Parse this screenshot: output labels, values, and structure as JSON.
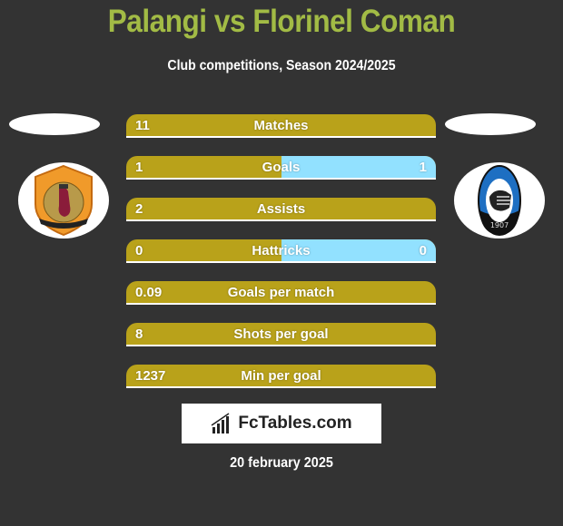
{
  "header": {
    "title": "Palangi vs Florinel Coman",
    "subtitle": "Club competitions, Season 2024/2025"
  },
  "colors": {
    "background": "#333333",
    "title": "#a2bb45",
    "left_bar": "#b9a21a",
    "right_bar": "#92e1ff"
  },
  "left_team": {
    "logo_icon": "qatar-sc-crest-icon"
  },
  "right_team": {
    "logo_icon": "atalanta-crest-icon"
  },
  "stats": [
    {
      "label": "Matches",
      "left": "11",
      "right": "",
      "right_share": 0
    },
    {
      "label": "Goals",
      "left": "1",
      "right": "1",
      "right_share": 0.5
    },
    {
      "label": "Assists",
      "left": "2",
      "right": "",
      "right_share": 0
    },
    {
      "label": "Hattricks",
      "left": "0",
      "right": "0",
      "right_share": 0.5
    },
    {
      "label": "Goals per match",
      "left": "0.09",
      "right": "",
      "right_share": 0
    },
    {
      "label": "Shots per goal",
      "left": "8",
      "right": "",
      "right_share": 0
    },
    {
      "label": "Min per goal",
      "left": "1237",
      "right": "",
      "right_share": 0
    }
  ],
  "brand": {
    "icon": "bar-chart-icon",
    "text": "FcTables.com"
  },
  "footer": {
    "date": "20 february 2025"
  }
}
